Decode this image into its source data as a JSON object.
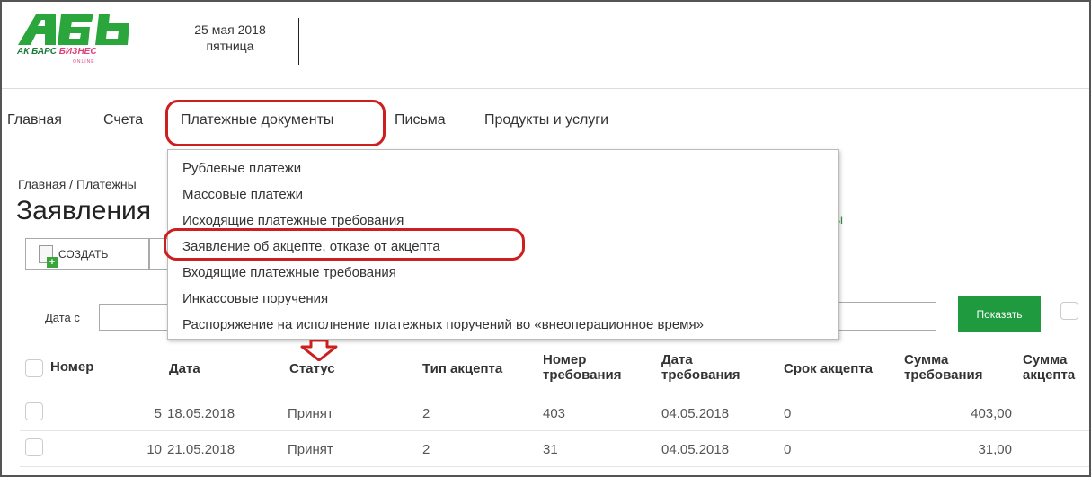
{
  "header": {
    "logo_brand_1": "АК БАРС",
    "logo_brand_2": "БИЗНЕС",
    "logo_online": "ONLINE",
    "date": "25 мая 2018",
    "weekday": "пятница"
  },
  "nav": {
    "items": [
      {
        "label": "Главная"
      },
      {
        "label": "Счета"
      },
      {
        "label": "Платежные документы"
      },
      {
        "label": "Письма"
      },
      {
        "label": "Продукты и услуги"
      }
    ]
  },
  "dropdown": {
    "items": [
      {
        "label": "Рублевые платежи"
      },
      {
        "label": "Массовые платежи"
      },
      {
        "label": "Исходящие платежные требования"
      },
      {
        "label": "Заявление об акцепте, отказе от акцепта"
      },
      {
        "label": "Входящие платежные требования"
      },
      {
        "label": "Инкассовые поручения"
      },
      {
        "label": "Распоряжение на исполнение платежных поручений во «внеоперационное время»"
      }
    ]
  },
  "page": {
    "breadcrumb": "Главная / Платежны",
    "title": "Заявления",
    "green_tail": "ы",
    "create_label": "СОЗДАТЬ",
    "date_from_label": "Дата с",
    "show_label": "Показать"
  },
  "table": {
    "headers": {
      "number": "Номер",
      "date": "Дата",
      "status": "Статус",
      "accept_type": "Тип акцепта",
      "req_number_1": "Номер",
      "req_number_2": "требования",
      "req_date_1": "Дата",
      "req_date_2": "требования",
      "accept_term": "Срок акцепта",
      "req_sum_1": "Сумма",
      "req_sum_2": "требования",
      "acc_sum_1": "Сумма",
      "acc_sum_2": "акцепта"
    },
    "rows": [
      {
        "number": "5",
        "date": "18.05.2018",
        "status": "Принят",
        "accept_type": "2",
        "req_number": "403",
        "req_date": "04.05.2018",
        "accept_term": "0",
        "req_sum": "403,00"
      },
      {
        "number": "10",
        "date": "21.05.2018",
        "status": "Принят",
        "accept_type": "2",
        "req_number": "31",
        "req_date": "04.05.2018",
        "accept_term": "0",
        "req_sum": "31,00"
      }
    ]
  },
  "colors": {
    "brand_green": "#1f9a3e",
    "brand_pink": "#e0407a",
    "highlight_red": "#cc1f1f"
  }
}
